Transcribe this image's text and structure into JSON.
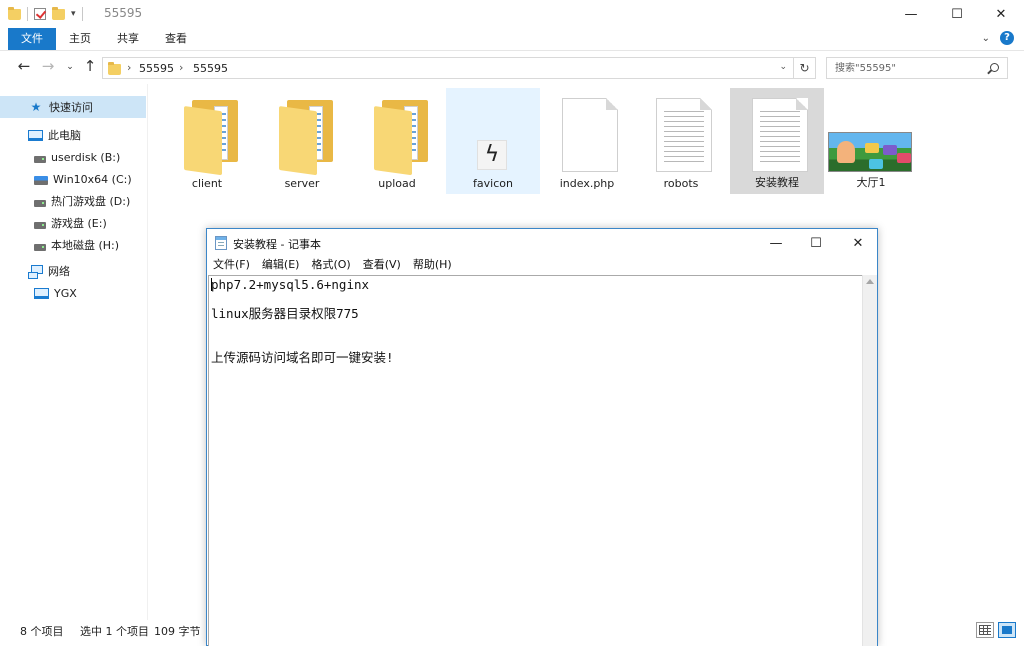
{
  "explorer": {
    "title": "55595",
    "ribbon_tabs": [
      "文件",
      "主页",
      "共享",
      "查看"
    ],
    "address": {
      "crumbs": [
        "55595",
        "55595"
      ]
    },
    "search": {
      "placeholder": "搜索\"55595\""
    },
    "nav": {
      "quick_access": "快速访问",
      "this_pc": "此电脑",
      "drives": [
        "userdisk (B:)",
        "Win10x64 (C:)",
        "热门游戏盘 (D:)",
        "游戏盘 (E:)",
        "本地磁盘 (H:)"
      ],
      "network": "网络",
      "network_items": [
        "YGX"
      ]
    },
    "files": [
      {
        "name": "client",
        "type": "folder"
      },
      {
        "name": "server",
        "type": "folder"
      },
      {
        "name": "upload",
        "type": "folder"
      },
      {
        "name": "favicon",
        "type": "image"
      },
      {
        "name": "index.php",
        "type": "file"
      },
      {
        "name": "robots",
        "type": "text"
      },
      {
        "name": "安装教程",
        "type": "text"
      },
      {
        "name": "大厅1",
        "type": "image"
      }
    ],
    "status": {
      "count": "8 个项目",
      "selection": "选中 1 个项目",
      "size": "109 字节"
    }
  },
  "notepad": {
    "title": "安装教程 - 记事本",
    "menu": [
      "文件(F)",
      "编辑(E)",
      "格式(O)",
      "查看(V)",
      "帮助(H)"
    ],
    "lines": [
      "php7.2+mysql5.6+nginx",
      "",
      "linux服务器目录权限775",
      "",
      "",
      "上传源码访问域名即可一键安装!"
    ]
  },
  "icons": {
    "folder": "folder-icon",
    "quick_access": "star-icon",
    "pc": "computer-icon",
    "drive": "drive-icon",
    "network": "network-icon",
    "search": "search-icon"
  },
  "colors": {
    "accent": "#1979ca",
    "selected": "#cde5f7",
    "folder": "#f8d775"
  }
}
